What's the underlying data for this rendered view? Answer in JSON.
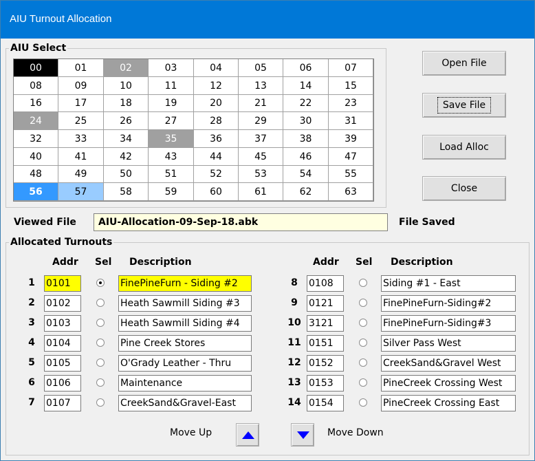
{
  "window": {
    "title": "AIU Turnout Allocation"
  },
  "aiu_select": {
    "legend": "AIU Select",
    "cells": [
      {
        "label": "00",
        "state": "black"
      },
      {
        "label": "01",
        "state": "normal"
      },
      {
        "label": "02",
        "state": "gray"
      },
      {
        "label": "03",
        "state": "normal"
      },
      {
        "label": "04",
        "state": "normal"
      },
      {
        "label": "05",
        "state": "normal"
      },
      {
        "label": "06",
        "state": "normal"
      },
      {
        "label": "07",
        "state": "normal"
      },
      {
        "label": "08",
        "state": "normal"
      },
      {
        "label": "09",
        "state": "normal"
      },
      {
        "label": "10",
        "state": "normal"
      },
      {
        "label": "11",
        "state": "normal"
      },
      {
        "label": "12",
        "state": "normal"
      },
      {
        "label": "13",
        "state": "normal"
      },
      {
        "label": "14",
        "state": "normal"
      },
      {
        "label": "15",
        "state": "normal"
      },
      {
        "label": "16",
        "state": "normal"
      },
      {
        "label": "17",
        "state": "normal"
      },
      {
        "label": "18",
        "state": "normal"
      },
      {
        "label": "19",
        "state": "normal"
      },
      {
        "label": "20",
        "state": "normal"
      },
      {
        "label": "21",
        "state": "normal"
      },
      {
        "label": "22",
        "state": "normal"
      },
      {
        "label": "23",
        "state": "normal"
      },
      {
        "label": "24",
        "state": "gray"
      },
      {
        "label": "25",
        "state": "normal"
      },
      {
        "label": "26",
        "state": "normal"
      },
      {
        "label": "27",
        "state": "normal"
      },
      {
        "label": "28",
        "state": "normal"
      },
      {
        "label": "29",
        "state": "normal"
      },
      {
        "label": "30",
        "state": "normal"
      },
      {
        "label": "31",
        "state": "normal"
      },
      {
        "label": "32",
        "state": "normal"
      },
      {
        "label": "33",
        "state": "normal"
      },
      {
        "label": "34",
        "state": "normal"
      },
      {
        "label": "35",
        "state": "gray"
      },
      {
        "label": "36",
        "state": "normal"
      },
      {
        "label": "37",
        "state": "normal"
      },
      {
        "label": "38",
        "state": "normal"
      },
      {
        "label": "39",
        "state": "normal"
      },
      {
        "label": "40",
        "state": "normal"
      },
      {
        "label": "41",
        "state": "normal"
      },
      {
        "label": "42",
        "state": "normal"
      },
      {
        "label": "43",
        "state": "normal"
      },
      {
        "label": "44",
        "state": "normal"
      },
      {
        "label": "45",
        "state": "normal"
      },
      {
        "label": "46",
        "state": "normal"
      },
      {
        "label": "47",
        "state": "normal"
      },
      {
        "label": "48",
        "state": "normal"
      },
      {
        "label": "49",
        "state": "normal"
      },
      {
        "label": "50",
        "state": "normal"
      },
      {
        "label": "51",
        "state": "normal"
      },
      {
        "label": "52",
        "state": "normal"
      },
      {
        "label": "53",
        "state": "normal"
      },
      {
        "label": "54",
        "state": "normal"
      },
      {
        "label": "55",
        "state": "normal"
      },
      {
        "label": "56",
        "state": "blue"
      },
      {
        "label": "57",
        "state": "lightblue"
      },
      {
        "label": "58",
        "state": "normal"
      },
      {
        "label": "59",
        "state": "normal"
      },
      {
        "label": "60",
        "state": "normal"
      },
      {
        "label": "61",
        "state": "normal"
      },
      {
        "label": "62",
        "state": "normal"
      },
      {
        "label": "63",
        "state": "normal"
      }
    ]
  },
  "cell_colors": {
    "normal": {
      "bg": "#ffffff",
      "fg": "#000000"
    },
    "black": {
      "bg": "#000000",
      "fg": "#ffffff"
    },
    "gray": {
      "bg": "#a0a0a0",
      "fg": "#ffffff"
    },
    "blue": {
      "bg": "#3399ff",
      "fg": "#ffffff"
    },
    "lightblue": {
      "bg": "#99ccff",
      "fg": "#000000"
    }
  },
  "buttons": {
    "open": "Open File",
    "save": "Save File",
    "load": "Load Alloc",
    "close": "Close"
  },
  "viewed_file": {
    "label": "Viewed File",
    "value": "AIU-Allocation-09-Sep-18.abk",
    "status": "File Saved"
  },
  "allocated": {
    "legend": "Allocated Turnouts",
    "headers": {
      "addr": "Addr",
      "sel": "Sel",
      "desc": "Description"
    },
    "left": [
      {
        "num": "1",
        "addr": "0101",
        "selected": true,
        "desc": "FinePineFurn - Siding #2",
        "highlight": true
      },
      {
        "num": "2",
        "addr": "0102",
        "selected": false,
        "desc": "Heath Sawmill Siding #3"
      },
      {
        "num": "3",
        "addr": "0103",
        "selected": false,
        "desc": "Heath Sawmill Siding #4"
      },
      {
        "num": "4",
        "addr": "0104",
        "selected": false,
        "desc": "Pine Creek Stores"
      },
      {
        "num": "5",
        "addr": "0105",
        "selected": false,
        "desc": "O'Grady Leather - Thru"
      },
      {
        "num": "6",
        "addr": "0106",
        "selected": false,
        "desc": "Maintenance"
      },
      {
        "num": "7",
        "addr": "0107",
        "selected": false,
        "desc": "CreekSand&Gravel-East"
      }
    ],
    "right": [
      {
        "num": "8",
        "addr": "0108",
        "selected": false,
        "desc": "Siding #1 - East"
      },
      {
        "num": "9",
        "addr": "0121",
        "selected": false,
        "desc": "FinePineFurn-Siding#2"
      },
      {
        "num": "10",
        "addr": "3121",
        "selected": false,
        "desc": "FinePineFurn-Siding#3"
      },
      {
        "num": "11",
        "addr": "0151",
        "selected": false,
        "desc": "Silver Pass West"
      },
      {
        "num": "12",
        "addr": "0152",
        "selected": false,
        "desc": "CreekSand&Gravel West"
      },
      {
        "num": "13",
        "addr": "0153",
        "selected": false,
        "desc": "PineCreek Crossing West"
      },
      {
        "num": "14",
        "addr": "0154",
        "selected": false,
        "desc": "PineCreek Crossing East"
      }
    ],
    "highlight_color": "#ffff00"
  },
  "move": {
    "up_label": "Move Up",
    "down_label": "Move Down",
    "arrow_color": "#0000ff"
  }
}
